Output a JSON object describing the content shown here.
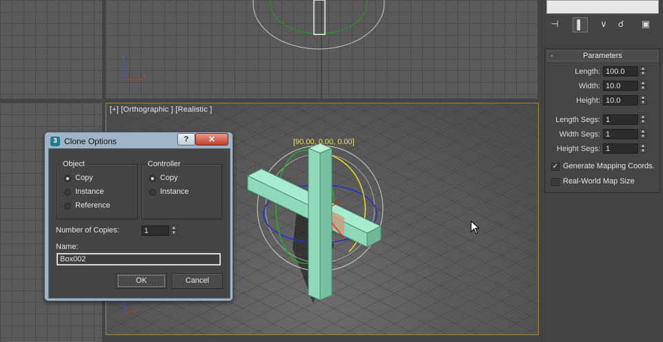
{
  "viewports": {
    "perspective": {
      "label": "[+] [Orthographic ] [Realistic ]",
      "rotation_readout": "[90.00, 0.00, 0.00]"
    }
  },
  "command_panel": {
    "rollout_title": "Parameters",
    "rollout_collapse": "-",
    "params": [
      {
        "label": "Length:",
        "value": "100.0"
      },
      {
        "label": "Width:",
        "value": "10.0"
      },
      {
        "label": "Height:",
        "value": "10.0"
      },
      {
        "label": "Length Segs:",
        "value": "1"
      },
      {
        "label": "Width Segs:",
        "value": "1"
      },
      {
        "label": "Height Segs:",
        "value": "1"
      }
    ],
    "options": [
      {
        "label": "Generate Mapping Coords.",
        "checked": true
      },
      {
        "label": "Real-World Map Size",
        "checked": false
      }
    ]
  },
  "clone_dialog": {
    "title": "Clone Options",
    "help_label": "?",
    "close_label": "✕",
    "object_group": {
      "title": "Object",
      "options": [
        "Copy",
        "Instance",
        "Reference"
      ],
      "selected": "Copy"
    },
    "controller_group": {
      "title": "Controller",
      "options": [
        "Copy",
        "Instance"
      ],
      "selected": "Copy"
    },
    "copies_label": "Number of Copies:",
    "copies_value": "1",
    "name_label": "Name:",
    "name_value": "Box002",
    "ok_label": "OK",
    "cancel_label": "Cancel"
  },
  "colors": {
    "box_fill": "#8fd8b8",
    "viewport_border": "#a88a2c",
    "readout": "#f0e060"
  }
}
